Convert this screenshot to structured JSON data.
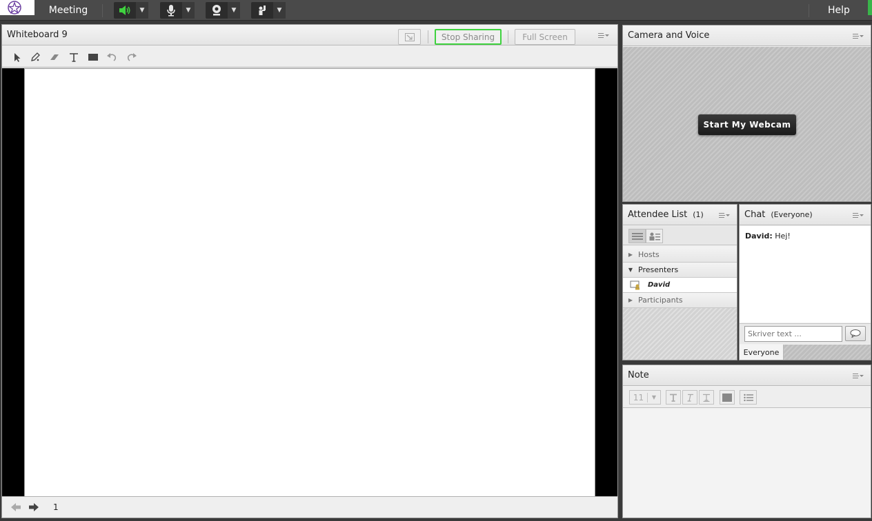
{
  "topbar": {
    "menu_label": "Meeting",
    "help_label": "Help",
    "colors": {
      "active_audio": "#3fd23f",
      "background": "#4a4a4a"
    }
  },
  "whiteboard": {
    "title": "Whiteboard 9",
    "stop_sharing_label": "Stop Sharing",
    "full_screen_label": "Full Screen",
    "page_number": "1",
    "accent_color": "#3ed23e"
  },
  "camera": {
    "title": "Camera and Voice",
    "start_webcam_label": "Start My Webcam"
  },
  "attendees": {
    "title": "Attendee List",
    "count": "(1)",
    "groups": {
      "hosts": "Hosts",
      "presenters": "Presenters",
      "presenter_name": "David",
      "participants": "Participants"
    }
  },
  "chat": {
    "title": "Chat",
    "scope": "(Everyone)",
    "messages": [
      {
        "author": "David:",
        "text": "Hej!"
      }
    ],
    "input_placeholder": "Skriver text ...",
    "tab_label": "Everyone"
  },
  "note": {
    "title": "Note",
    "font_size": "11"
  }
}
